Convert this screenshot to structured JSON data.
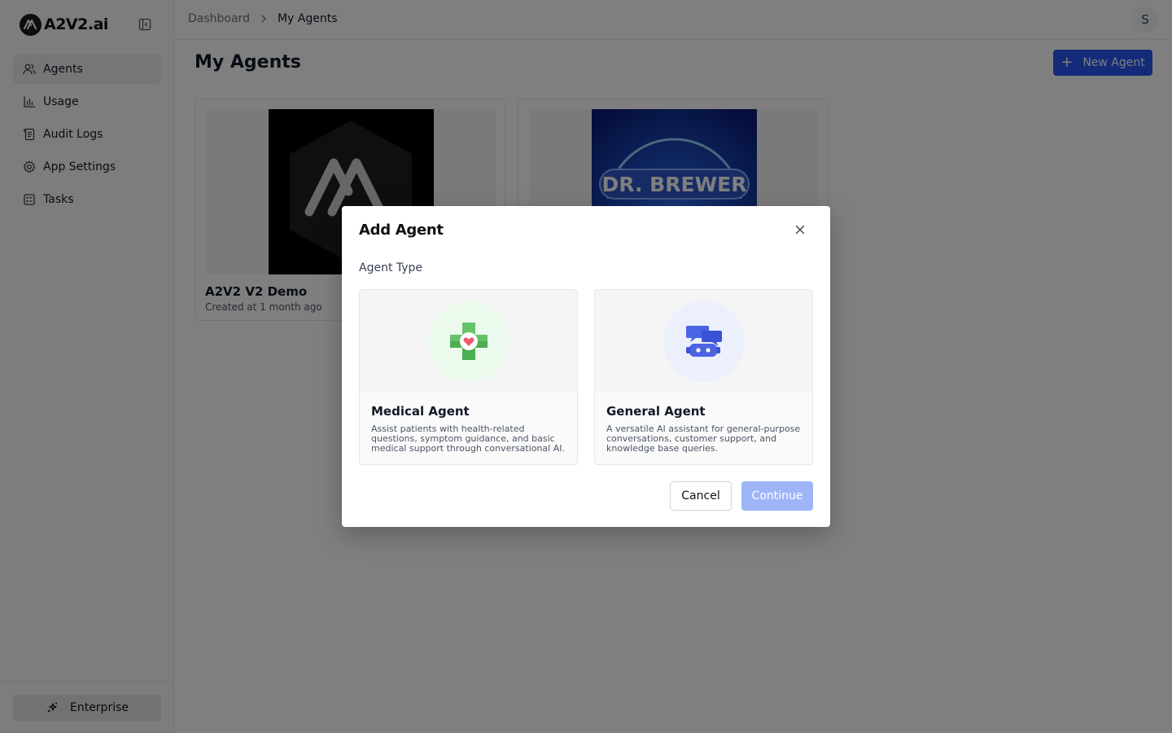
{
  "app": {
    "logo_text": "A2V2.ai"
  },
  "sidebar": {
    "items": [
      {
        "label": "Agents",
        "icon": "users-icon",
        "active": true
      },
      {
        "label": "Usage",
        "icon": "bar-chart-icon"
      },
      {
        "label": "Audit Logs",
        "icon": "scroll-icon"
      },
      {
        "label": "App Settings",
        "icon": "gear-icon"
      },
      {
        "label": "Tasks",
        "icon": "task-list-icon"
      }
    ],
    "footer_label": "Enterprise"
  },
  "header": {
    "breadcrumb": [
      "Dashboard",
      "My Agents"
    ],
    "user_initial": "S"
  },
  "main": {
    "title": "My Agents",
    "new_agent_label": "New Agent",
    "agents": [
      {
        "name": "A2V2 V2 Demo",
        "created": "Created at 1 month ago"
      },
      {
        "name": "",
        "created": "",
        "thumb_text": "DR. BREWER"
      }
    ]
  },
  "modal": {
    "title": "Add Agent",
    "section_label": "Agent Type",
    "types": [
      {
        "name": "Medical Agent",
        "description": "Assist patients with health-related questions, symptom guidance, and basic medical support through conversational AI.",
        "icon": "medical-cross-icon"
      },
      {
        "name": "General Agent",
        "description": "A versatile AI assistant for general-purpose conversations, customer support, and knowledge base queries.",
        "icon": "robot-chat-icon"
      }
    ],
    "cancel_label": "Cancel",
    "continue_label": "Continue"
  },
  "colors": {
    "primary": "#2956f5",
    "primary_disabled": "#9db5f8",
    "medical_circle": "#ecfaee",
    "general_circle": "#eceffc"
  }
}
